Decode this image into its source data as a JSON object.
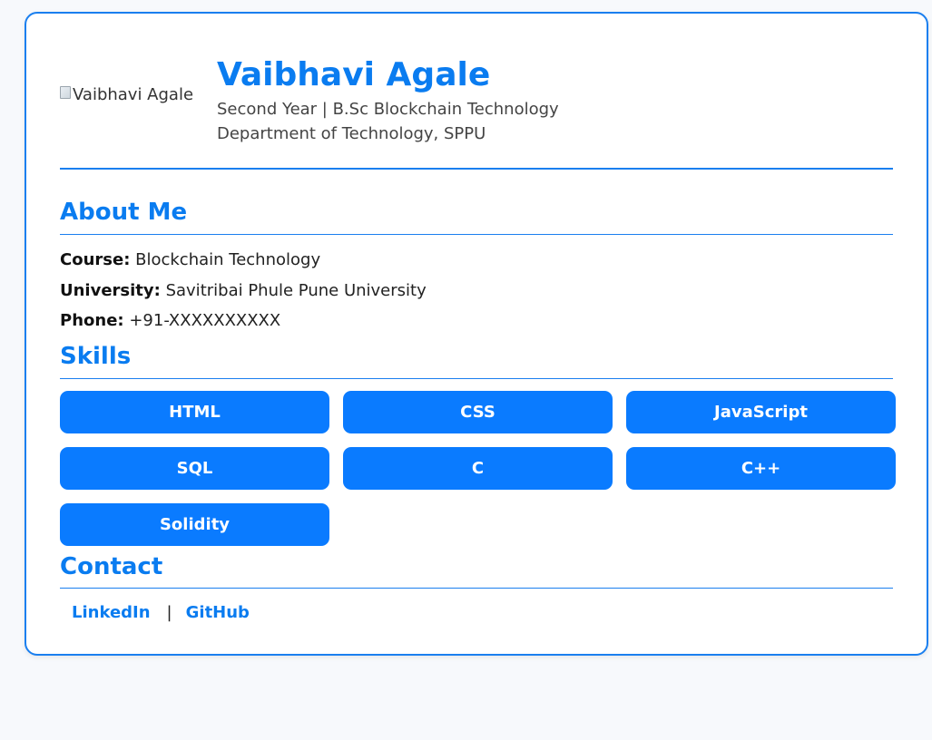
{
  "profile": {
    "photo_alt": "Vaibhavi Agale",
    "name": "Vaibhavi Agale",
    "year_program": "Second Year | B.Sc Blockchain Technology",
    "department": "Department of Technology, SPPU"
  },
  "about": {
    "title": "About Me",
    "course_label": "Course:",
    "course_value": "Blockchain Technology",
    "university_label": "University:",
    "university_value": "Savitribai Phule Pune University",
    "phone_label": "Phone:",
    "phone_value": "+91-XXXXXXXXXX"
  },
  "skills": {
    "title": "Skills",
    "items": [
      "HTML",
      "CSS",
      "JavaScript",
      "SQL",
      "C",
      "C++",
      "Solidity"
    ]
  },
  "contact": {
    "title": "Contact",
    "linkedin_label": "LinkedIn",
    "separator": "|",
    "github_label": "GitHub"
  },
  "colors": {
    "accent": "#0a7cf0",
    "button": "#0a7bff",
    "border": "#1a7fef",
    "page_background": "#f7f9fc"
  }
}
